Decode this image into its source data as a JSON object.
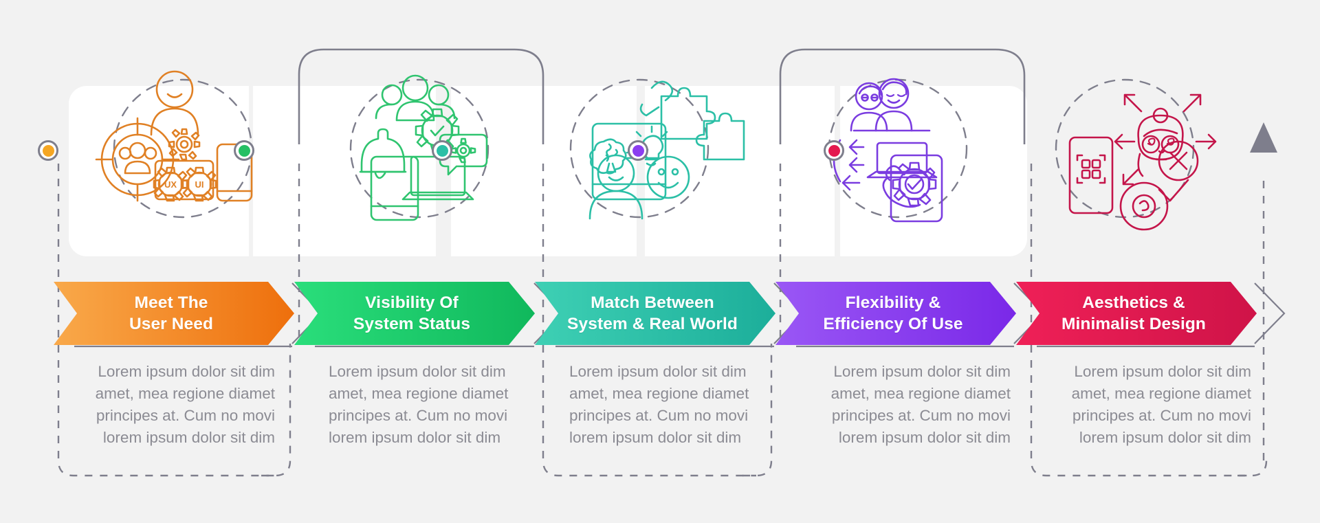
{
  "diagram": {
    "type": "process-timeline-infographic",
    "background_color": "#f2f2f2",
    "card_color": "#ffffff",
    "line_color": "#7e7e8c",
    "body_text_color": "#8b8b93",
    "end_marker": "triangle-up-arrow",
    "steps": [
      {
        "id": "step-1",
        "label_line1": "Meet The",
        "label_line2": "User Need",
        "color": "#f07d1a",
        "gradient_from": "#f9a94a",
        "gradient_to": "#ee6f0c",
        "node_color": "#f5a623",
        "body": "Lorem ipsum dolor sit dim amet, mea regione diamet principes at. Cum no movi lorem ipsum dolor sit dim",
        "icons": [
          "target-audience-icon",
          "person-with-gear-icon",
          "ux-gear-icon",
          "ui-gear-icon",
          "smartphone-icon"
        ]
      },
      {
        "id": "step-2",
        "label_line1": "Visibility Of",
        "label_line2": "System Status",
        "color": "#1fc16b",
        "gradient_from": "#2ade7b",
        "gradient_to": "#10b85c",
        "node_color": "#25bf64",
        "body": "Lorem ipsum dolor sit dim amet, mea regione diamet principes at. Cum no movi lorem ipsum dolor sit dim",
        "icons": [
          "bell-notification-icon",
          "smartphone-icon",
          "user-group-gear-check-icon",
          "laptop-chat-gear-icon"
        ]
      },
      {
        "id": "step-3",
        "label_line1": "Match Between",
        "label_line2": "System & Real World",
        "color": "#2bbfa6",
        "gradient_from": "#3ed0b4",
        "gradient_to": "#1cae9a",
        "node_color": "#2bbfa6",
        "body": "Lorem ipsum dolor sit dim amet, mea regione diamet principes at. Cum no movi lorem ipsum dolor sit dim",
        "icons": [
          "brain-equals-lightbulb-icon",
          "hand-puzzle-piece-icon",
          "person-happy-thought-icon"
        ]
      },
      {
        "id": "step-4",
        "label_line1": "Flexibility &",
        "label_line2": "Efficiency Of Use",
        "color": "#8b3ef0",
        "gradient_from": "#9a57f5",
        "gradient_to": "#7a28e8",
        "node_color": "#8b3ef0",
        "body": "Lorem ipsum dolor sit dim amet, mea regione diamet principes at. Cum no movi lorem ipsum dolor sit dim",
        "icons": [
          "two-users-laptop-icon",
          "arrows-left-icon",
          "hand-phone-gear-check-icon"
        ]
      },
      {
        "id": "step-5",
        "label_line1": "Aesthetics &",
        "label_line2": "Minimalist Design",
        "color": "#e4194f",
        "gradient_from": "#ef2057",
        "gradient_to": "#cf1348",
        "node_color": "#e4194f",
        "body": "Lorem ipsum dolor sit dim amet, mea regione diamet principes at. Cum no movi lorem ipsum dolor sit dim",
        "icons": [
          "phone-grid-scan-icon",
          "dizzy-face-arrows-icon",
          "x-circle-icon",
          "eye-check-icon"
        ]
      }
    ]
  }
}
